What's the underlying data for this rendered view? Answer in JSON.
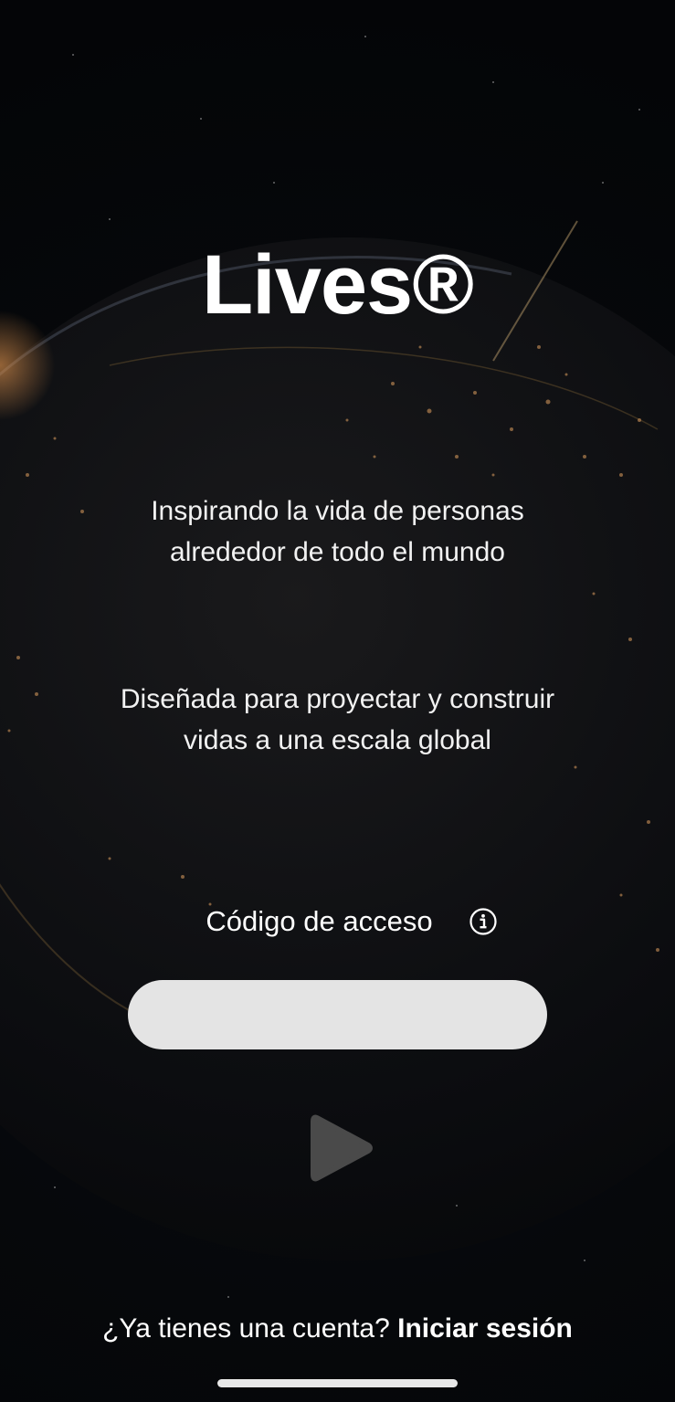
{
  "app": {
    "title": "Lives®"
  },
  "taglines": {
    "first_line1": "Inspirando la vida de personas",
    "first_line2": "alrededor de todo el mundo",
    "second_line1": "Diseñada para proyectar y construir",
    "second_line2": "vidas a una escala global"
  },
  "access": {
    "label": "Código de acceso",
    "input_value": "",
    "info_icon": "info-circle-icon",
    "submit_icon": "play-icon"
  },
  "account": {
    "prompt": "¿Ya tienes una cuenta?",
    "signin_label": "Iniciar sesión"
  },
  "colors": {
    "background": "#05070a",
    "input_background": "#e4e4e4",
    "play_button": "#4a4a4a",
    "text": "#ffffff"
  }
}
